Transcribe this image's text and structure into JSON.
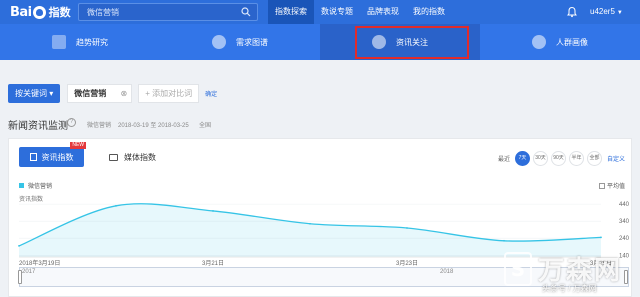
{
  "topbar": {
    "logo_text": "Bai",
    "logo_sub": "指数",
    "search": {
      "value": "微信营销",
      "placeholder": ""
    },
    "nav": [
      "指数探索",
      "数说专题",
      "品牌表现",
      "我的指数"
    ],
    "active_nav": "指数探索",
    "username": "u42er5"
  },
  "subnav": {
    "tabs": [
      "趋势研究",
      "需求图谱",
      "资讯关注",
      "人群画像"
    ],
    "active_tab": "资讯关注",
    "highlight_color": "#e02b2b"
  },
  "controls": {
    "keyword_button": "按关键词",
    "keyword": "微信营销",
    "add_compare": "+ 添加对比词",
    "confirm": "确定"
  },
  "section": {
    "title": "新闻资讯监测",
    "keyword": "微信营销",
    "date_range": "2018-03-19 至 2018-03-25",
    "region": "全国"
  },
  "panel": {
    "tab_news": "资讯指数",
    "tab_news_badge": "NEW",
    "tab_media": "媒体指数",
    "range_label": "最近",
    "ranges": [
      "7天",
      "30天",
      "90天",
      "半年",
      "全部"
    ],
    "active_range": "7天",
    "custom": "自定义",
    "legend": "微信营销",
    "avg_label": "平均值",
    "y_name": "资讯指数"
  },
  "chart_data": {
    "type": "area",
    "series": [
      {
        "name": "微信营销",
        "x": [
          "2018-03-19",
          "2018-03-20",
          "2018-03-21",
          "2018-03-22",
          "2018-03-23",
          "2018-03-24",
          "2018-03-25"
        ],
        "values": [
          195,
          430,
          400,
          325,
          300,
          225,
          245
        ],
        "color": "#36c4e6"
      }
    ],
    "yticks": [
      140,
      240,
      340,
      440
    ],
    "ylim": [
      130,
      470
    ],
    "xtick_labels": [
      "2018年3月19日",
      "3月21日",
      "3月23日",
      "3月25日"
    ],
    "grid": true
  },
  "slider": {
    "years": [
      "2017",
      "2018"
    ]
  },
  "watermark": {
    "brand": "万森网",
    "sub": "头条号 / 万森网"
  }
}
